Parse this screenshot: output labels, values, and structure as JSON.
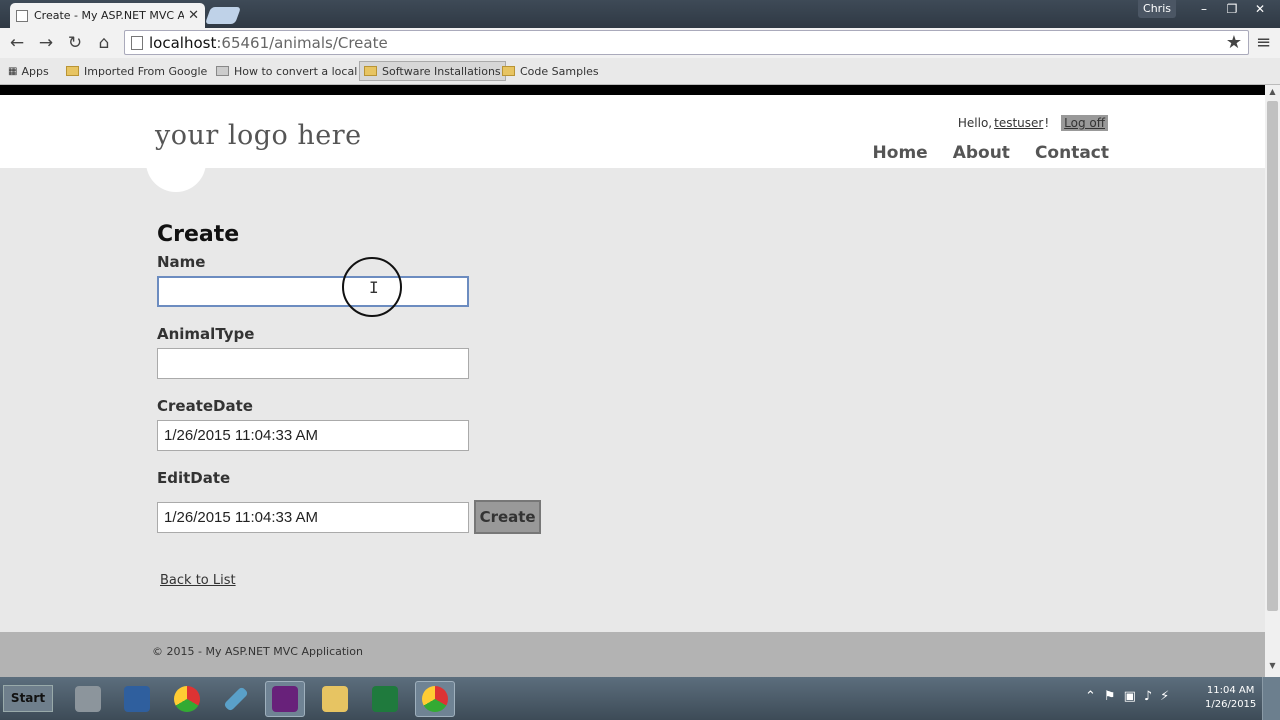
{
  "browser": {
    "tab_title": "Create - My ASP.NET MVC Ap",
    "user_badge": "Chris",
    "url_host": "localhost",
    "url_path": ":65461/animals/Create",
    "bookmarks": [
      {
        "label": "Apps"
      },
      {
        "label": "Imported From Google"
      },
      {
        "label": "How to convert a local"
      },
      {
        "label": "Software Installations"
      },
      {
        "label": "Code Samples"
      }
    ]
  },
  "site": {
    "logo": "your logo here",
    "greeting_prefix": "Hello, ",
    "username": "testuser",
    "greeting_suffix": "!",
    "logoff_label": "Log off",
    "nav": [
      "Home",
      "About",
      "Contact"
    ],
    "footer": "© 2015 - My ASP.NET MVC Application"
  },
  "form": {
    "title": "Create",
    "fields": [
      {
        "label": "Name",
        "value": ""
      },
      {
        "label": "AnimalType",
        "value": ""
      },
      {
        "label": "CreateDate",
        "value": "1/26/2015 11:04:33 AM"
      },
      {
        "label": "EditDate",
        "value": "1/26/2015 11:04:33 AM"
      }
    ],
    "submit_label": "Create",
    "back_link": "Back to List"
  },
  "taskbar": {
    "start_label": "Start",
    "clock_time": "11:04 AM",
    "clock_date": "1/26/2015"
  },
  "colors": {
    "page_background": "#e8e8e8",
    "footer_background": "#b3b3b3",
    "button_background": "#999999"
  }
}
